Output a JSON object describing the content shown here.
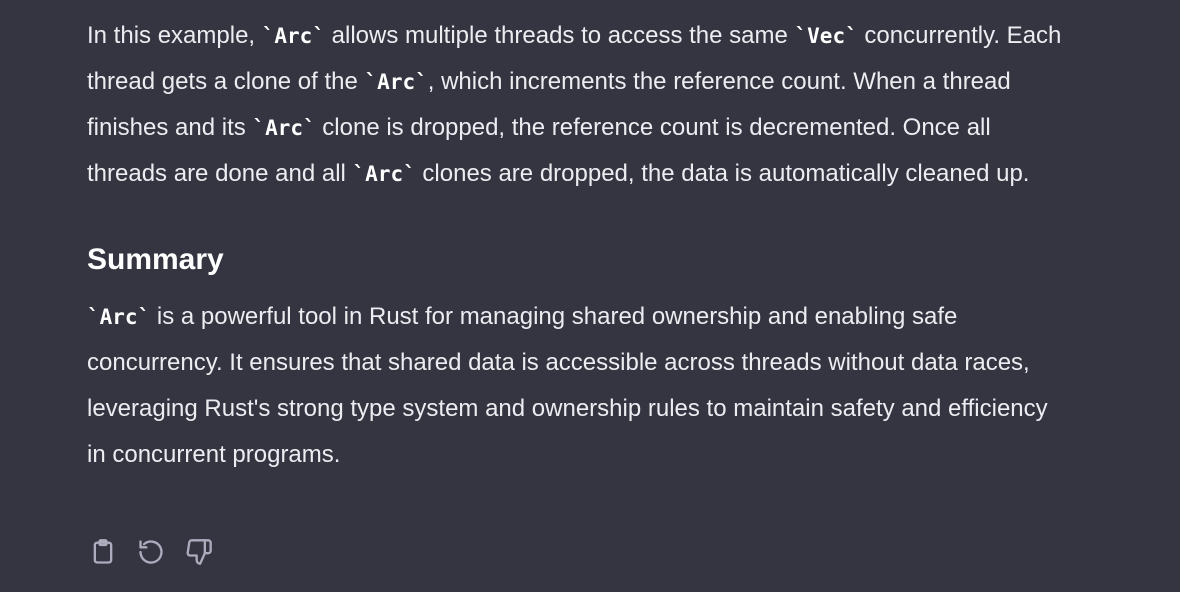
{
  "message": {
    "para1": {
      "t1": "In this example, ",
      "c1": "`Arc`",
      "t2": " allows multiple threads to access the same ",
      "c2": "`Vec`",
      "t3": " concurrently. Each thread gets a clone of the ",
      "c3": "`Arc`",
      "t4": ", which increments the reference count. When a thread finishes and its ",
      "c4": "`Arc`",
      "t5": " clone is dropped, the reference count is decremented. Once all threads are done and all ",
      "c5": "`Arc`",
      "t6": " clones are dropped, the data is automatically cleaned up."
    },
    "heading": "Summary",
    "para2": {
      "c1": "`Arc`",
      "t1": " is a powerful tool in Rust for managing shared ownership and enabling safe concurrency. It ensures that shared data is accessible across threads without data races, leveraging Rust's strong type system and ownership rules to maintain safety and efficiency in concurrent programs."
    }
  },
  "actions": {
    "copy_icon": "clipboard-icon",
    "regenerate_icon": "refresh-icon",
    "dislike_icon": "thumbs-down-icon"
  },
  "colors": {
    "background": "#343541",
    "text": "#ececf1",
    "icon": "#acacbe"
  }
}
